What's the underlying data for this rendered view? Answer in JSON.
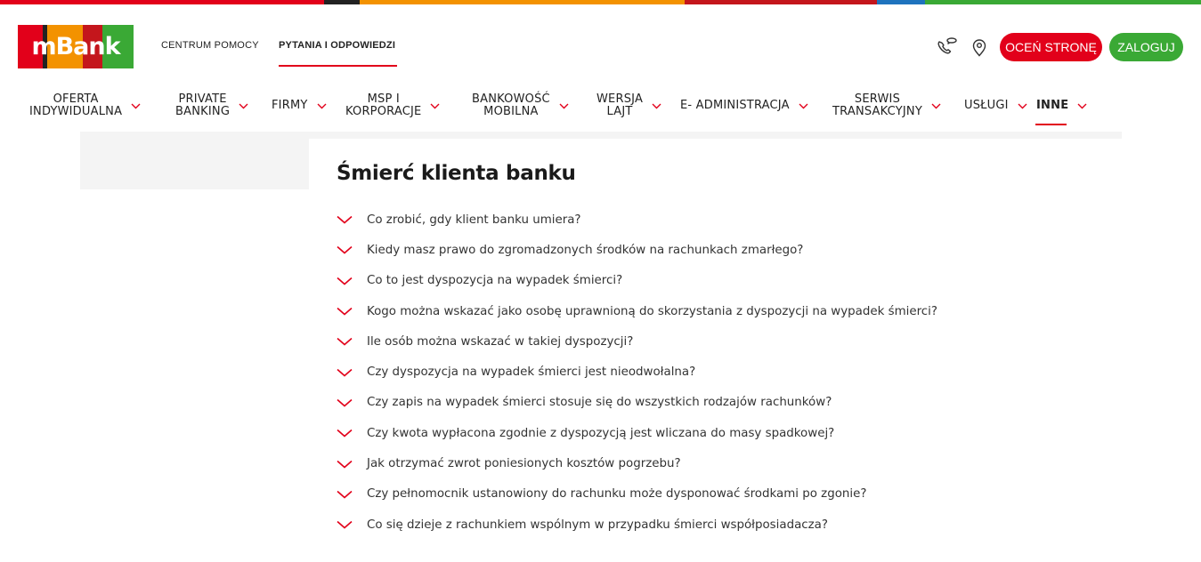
{
  "colors": {
    "brand_red": "#e2001a",
    "brand_green": "#3aa935",
    "brand_orange": "#f39200",
    "logo_red": "#e2001a",
    "logo_orange": "#f39200",
    "logo_dark_red": "#c4161c",
    "logo_green": "#3aa935"
  },
  "logo": {
    "text": "mBank"
  },
  "header_links": {
    "help_center": "CENTRUM POMOCY",
    "qa": "PYTANIA I ODPOWIEDZI"
  },
  "header_icons": {
    "contact": "phone-chat-icon",
    "location": "map-pin-icon"
  },
  "header_buttons": {
    "rate": "OCEŃ STRONĘ",
    "login": "ZALOGUJ"
  },
  "nav": {
    "items": [
      {
        "label": "OFERTA\nINDYWIDUALNA"
      },
      {
        "label": "PRIVATE\nBANKING"
      },
      {
        "label": "FIRMY"
      },
      {
        "label": "MSP I\nKORPORACJE"
      },
      {
        "label": "BANKOWOŚĆ\nMOBILNA"
      },
      {
        "label": "WERSJA\nLAJT"
      },
      {
        "label": "E- ADMINISTRACJA"
      },
      {
        "label": "SERWIS\nTRANSAKCYJNY"
      },
      {
        "label": "USŁUGI"
      },
      {
        "label": "INNE"
      }
    ]
  },
  "page": {
    "title": "Śmierć klienta banku"
  },
  "faq": {
    "items": [
      "Co zrobić, gdy klient banku umiera?",
      "Kiedy masz prawo do zgromadzonych środków na rachunkach zmarłego?",
      "Co to jest dyspozycja na wypadek śmierci?",
      "Kogo można wskazać jako osobę uprawnioną do skorzystania z dyspozycji na wypadek śmierci?",
      "Ile osób można wskazać w takiej dyspozycji?",
      "Czy dyspozycja na wypadek śmierci jest nieodwołalna?",
      "Czy zapis na wypadek śmierci stosuje się do wszystkich rodzajów rachunków?",
      "Czy kwota wypłacona zgodnie z dyspozycją jest wliczana do masy spadkowej?",
      "Jak otrzymać zwrot poniesionych kosztów pogrzebu?",
      "Czy pełnomocnik ustanowiony do rachunku może dysponować środkami po zgonie?",
      "Co się dzieje z rachunkiem wspólnym w przypadku śmierci współposiadacza?"
    ]
  }
}
